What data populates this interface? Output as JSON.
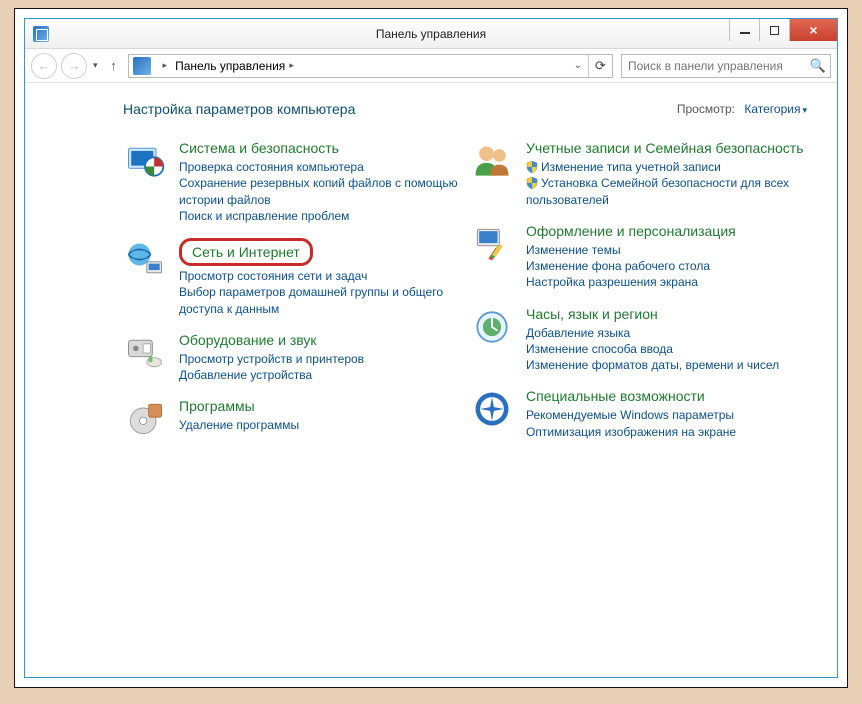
{
  "window": {
    "title": "Панель управления"
  },
  "breadcrumb": {
    "root": "Панель управления"
  },
  "search": {
    "placeholder": "Поиск в панели управления"
  },
  "heading": "Настройка параметров компьютера",
  "viewby": {
    "label": "Просмотр:",
    "value": "Категория"
  },
  "categories": {
    "system": {
      "title": "Система и безопасность",
      "links": [
        "Проверка состояния компьютера",
        "Сохранение резервных копий файлов с помощью истории файлов",
        "Поиск и исправление проблем"
      ]
    },
    "network": {
      "title": "Сеть и Интернет",
      "links": [
        "Просмотр состояния сети и задач",
        "Выбор параметров домашней группы и общего доступа к данным"
      ]
    },
    "hardware": {
      "title": "Оборудование и звук",
      "links": [
        "Просмотр устройств и принтеров",
        "Добавление устройства"
      ]
    },
    "programs": {
      "title": "Программы",
      "links": [
        "Удаление программы"
      ]
    },
    "users": {
      "title": "Учетные записи и Семейная безопасность",
      "links": [
        "Изменение типа учетной записи",
        "Установка Семейной безопасности для всех пользователей"
      ]
    },
    "appearance": {
      "title": "Оформление и персонализация",
      "links": [
        "Изменение темы",
        "Изменение фона рабочего стола",
        "Настройка разрешения экрана"
      ]
    },
    "clock": {
      "title": "Часы, язык и регион",
      "links": [
        "Добавление языка",
        "Изменение способа ввода",
        "Изменение форматов даты, времени и чисел"
      ]
    },
    "ease": {
      "title": "Специальные возможности",
      "links": [
        "Рекомендуемые Windows параметры",
        "Оптимизация изображения на экране"
      ]
    }
  }
}
